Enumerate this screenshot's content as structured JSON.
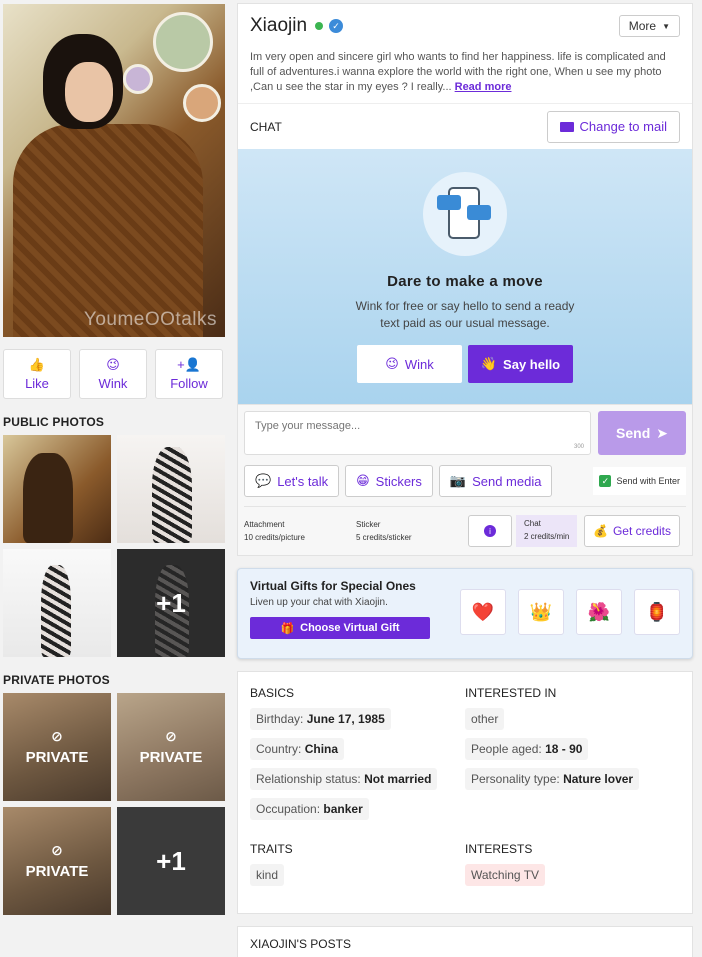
{
  "profile": {
    "name": "Xiaojin",
    "more_label": "More",
    "bio": "Im very open and sincere girl who wants to find her happiness. life is complicated and full of adventures.i wanna explore the world with the right one, When u see my photo ,Can u see the star in my eyes ? I really...",
    "read_more": "Read more",
    "watermark": "YoumeOOtalks"
  },
  "actions": [
    {
      "label": "Like",
      "icon": "thumbs-up-icon",
      "glyph": "👍"
    },
    {
      "label": "Wink",
      "icon": "wink-emoji-icon",
      "glyph": "😉"
    },
    {
      "label": "Follow",
      "icon": "add-person-icon",
      "glyph": "+👤"
    }
  ],
  "public_photos": {
    "title": "PUBLIC PHOTOS",
    "more_count": "+1"
  },
  "private_photos": {
    "title": "PRIVATE PHOTOS",
    "label": "PRIVATE",
    "more_count": "+1"
  },
  "chat": {
    "label": "CHAT",
    "change_mail": "Change to mail",
    "hero_title": "Dare to make a move",
    "hero_text": "Wink for free or say hello to send a ready text paid as our usual message.",
    "wink": "Wink",
    "say_hello": "Say hello",
    "placeholder": "Type your message...",
    "char_count": "300",
    "send": "Send",
    "lets_talk": "Let's talk",
    "stickers": "Stickers",
    "send_media": "Send media",
    "send_with_enter": "Send with Enter"
  },
  "credits": {
    "attachment_label": "Attachment",
    "attachment_cost": "10 credits/picture",
    "sticker_label": "Sticker",
    "sticker_cost": "5 credits/sticker",
    "chat_label": "Chat",
    "chat_cost": "2 credits/min",
    "get_credits": "Get credits"
  },
  "gifts": {
    "title": "Virtual Gifts for Special Ones",
    "subtitle": "Liven up your chat with Xiaojin.",
    "button": "Choose Virtual Gift"
  },
  "basics": {
    "title": "BASICS",
    "birthday_label": "Birthday:",
    "birthday": "June 17, 1985",
    "country_label": "Country:",
    "country": "China",
    "relationship_label": "Relationship status:",
    "relationship": "Not married",
    "occupation_label": "Occupation:",
    "occupation": "banker"
  },
  "interested_in": {
    "title": "INTERESTED IN",
    "gender": "other",
    "age_label": "People aged:",
    "age": "18 - 90",
    "personality_label": "Personality type:",
    "personality": "Nature lover"
  },
  "traits": {
    "title": "TRAITS",
    "items": [
      "kind"
    ]
  },
  "interests": {
    "title": "INTERESTS",
    "items": [
      "Watching TV"
    ]
  },
  "posts": {
    "title": "XIAOJIN'S POSTS"
  },
  "colors": {
    "accent": "#6c2bd9",
    "online": "#3cb551",
    "verified": "#3c8bd9"
  }
}
